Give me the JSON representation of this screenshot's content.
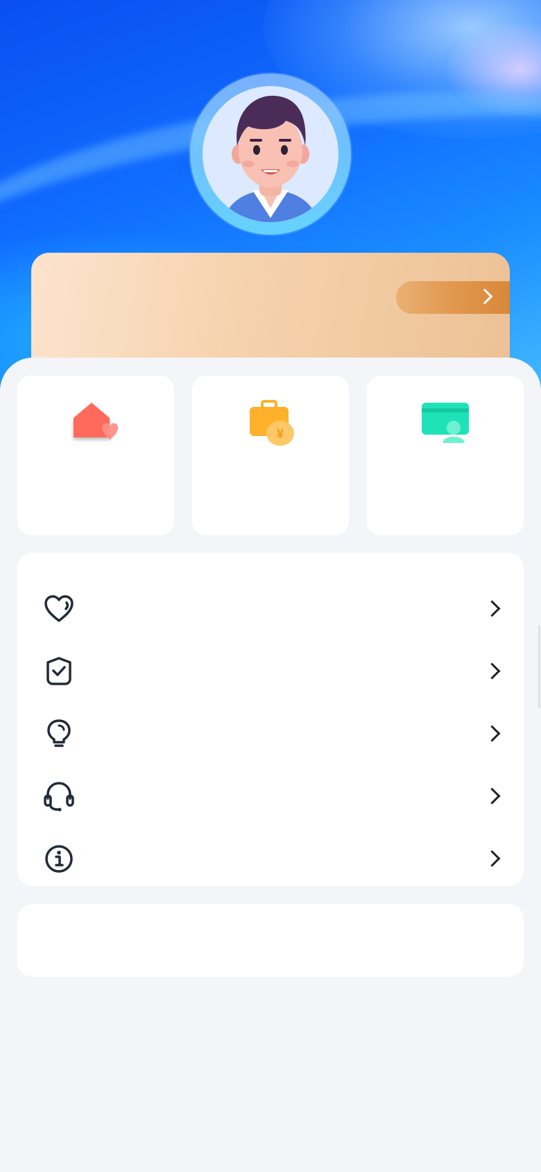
{
  "header": {
    "avatar": "male-user-avatar"
  },
  "vip_card": {
    "title": "",
    "action_label": "",
    "chevron": "chevron-right-icon"
  },
  "shortcuts": [
    {
      "icon": "home-heart-icon",
      "label": "",
      "color": "#ff6b5a"
    },
    {
      "icon": "briefcase-money-icon",
      "label": "",
      "color": "#ffb12b"
    },
    {
      "icon": "id-card-icon",
      "label": "",
      "color": "#1ee3b8"
    }
  ],
  "menu": {
    "items": [
      {
        "icon": "heart-icon",
        "label": ""
      },
      {
        "icon": "shield-check-icon",
        "label": ""
      },
      {
        "icon": "lightbulb-icon",
        "label": ""
      },
      {
        "icon": "headset-icon",
        "label": ""
      },
      {
        "icon": "info-icon",
        "label": ""
      }
    ]
  },
  "bottom": {
    "label": ""
  },
  "colors": {
    "page_bg": "#f3f5f9",
    "hero_blue": "#0f6bff",
    "card_gold": "#edc195",
    "pill_orange": "#e0964c",
    "icon_dark": "#222a36"
  }
}
